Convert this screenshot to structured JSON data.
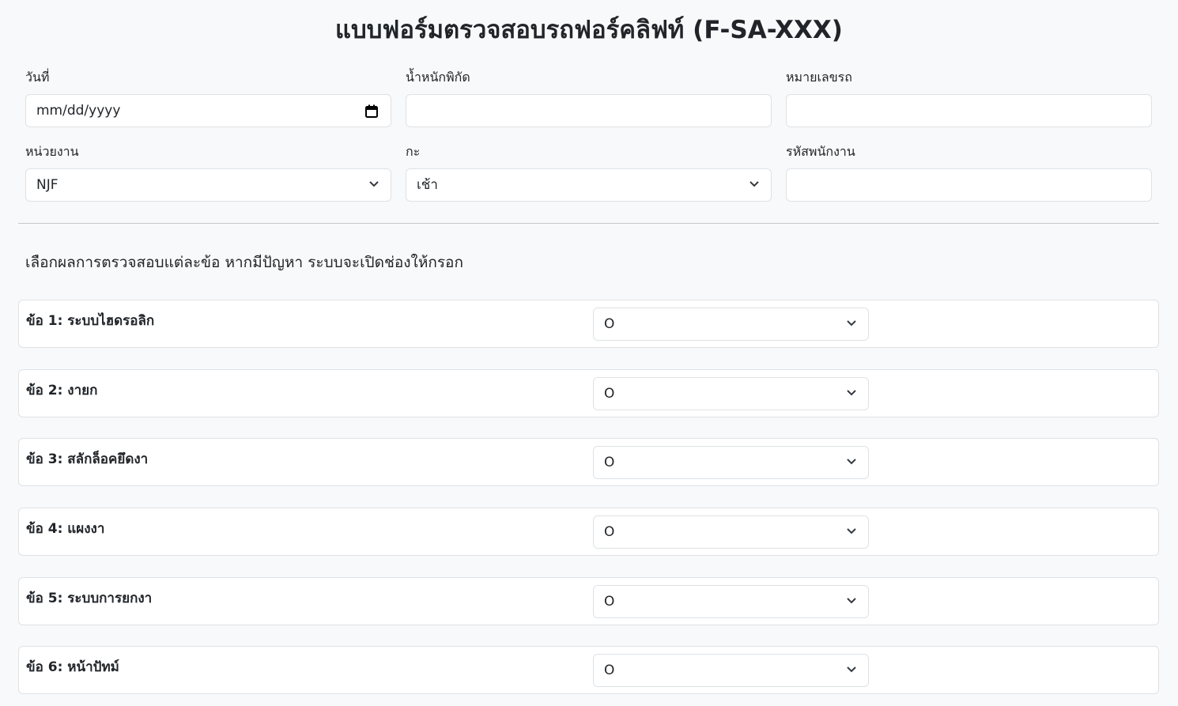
{
  "header": {
    "title": "แบบฟอร์มตรวจสอบรถฟอร์คลิฟท์ (F-SA-XXX)"
  },
  "form": {
    "date": {
      "label": "วันที่",
      "value": "mm/dd/yyyy"
    },
    "weight": {
      "label": "น้ำหนักพิกัด",
      "value": ""
    },
    "vehicle_no": {
      "label": "หมายเลขรถ",
      "value": ""
    },
    "unit": {
      "label": "หน่วยงาน",
      "value": "NJF"
    },
    "shift": {
      "label": "กะ",
      "value": "เช้า"
    },
    "employee_id": {
      "label": "รหัสพนักงาน",
      "value": ""
    }
  },
  "instructions": "เลือกผลการตรวจสอบแต่ละข้อ หากมีปัญหา ระบบจะเปิดช่องให้กรอก",
  "checklist": [
    {
      "label": "ข้อ 1: ระบบไฮดรอลิก",
      "value": "O"
    },
    {
      "label": "ข้อ 2: งายก",
      "value": "O"
    },
    {
      "label": "ข้อ 3: สลักล็อคยึดงา",
      "value": "O"
    },
    {
      "label": "ข้อ 4: แผงงา",
      "value": "O"
    },
    {
      "label": "ข้อ 5: ระบบการยกงา",
      "value": "O"
    },
    {
      "label": "ข้อ 6: หน้าปัทม์",
      "value": "O"
    }
  ],
  "icons": {
    "calendar": "calendar-icon",
    "dropdown": "chevron-down-icon"
  }
}
